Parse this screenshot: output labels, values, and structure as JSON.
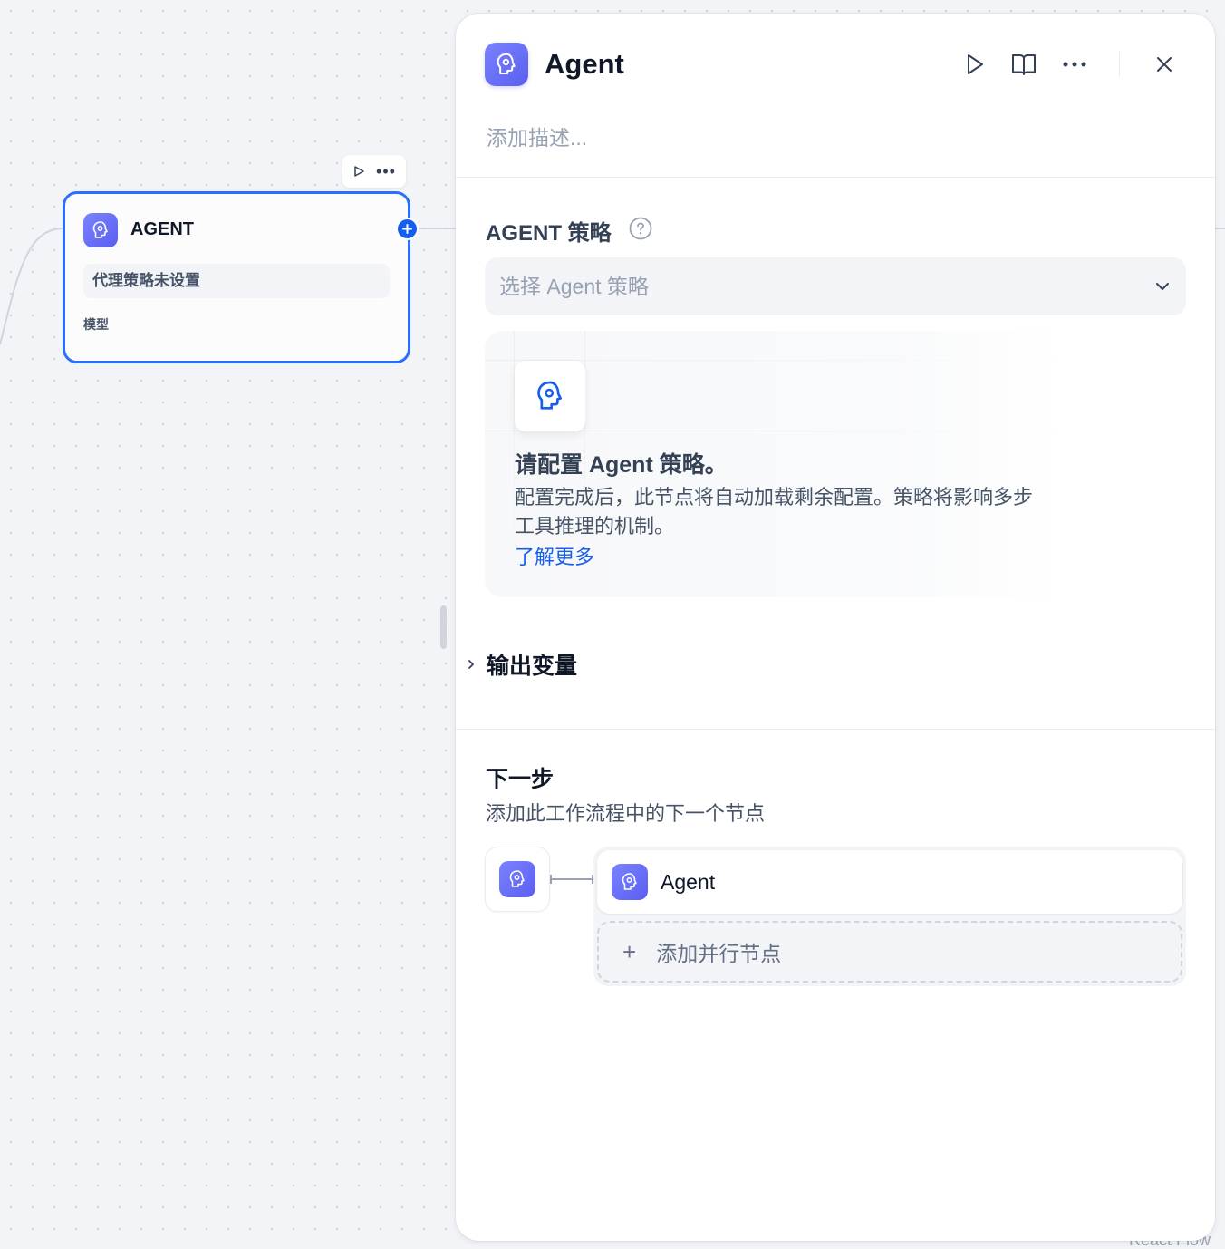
{
  "canvas": {
    "node": {
      "title": "AGENT",
      "strategy_status": "代理策略未设置",
      "model_label": "模型"
    },
    "footer_text": "React Flow"
  },
  "panel": {
    "title": "Agent",
    "description_placeholder": "添加描述...",
    "strategy_section": {
      "title": "AGENT 策略",
      "select_placeholder": "选择 Agent 策略",
      "empty_title": "请配置 Agent 策略。",
      "empty_text": "配置完成后，此节点将自动加载剩余配置。策略将影响多步工具推理的机制。",
      "learn_more": "了解更多"
    },
    "output_section": {
      "title": "输出变量"
    },
    "next_step": {
      "title": "下一步",
      "subtitle": "添加此工作流程中的下一个节点",
      "next_node_label": "Agent",
      "add_parallel_label": "添加并行节点"
    }
  },
  "colors": {
    "accent": "#155eef",
    "node_border": "#2970ff",
    "agent_icon_bg": "#6366f1"
  },
  "icons": [
    "agent-brain-icon",
    "play-icon",
    "book-icon",
    "more-icon",
    "close-icon",
    "help-icon",
    "chevron-down-icon",
    "chevron-right-icon",
    "plus-icon"
  ]
}
